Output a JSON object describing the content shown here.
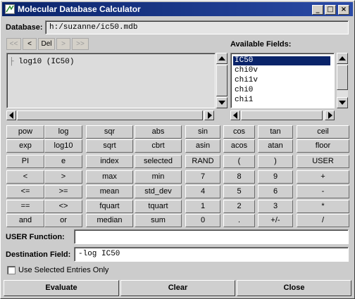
{
  "window": {
    "title": "Molecular Database Calculator",
    "controls": {
      "minimize": "_",
      "maximize": "□",
      "close": "×"
    }
  },
  "database": {
    "label": "Database:",
    "value": "h:/suzanne/ic50.mdb"
  },
  "nav": {
    "first": "<<",
    "prev": "<",
    "del": "Del",
    "next": ">",
    "last": ">>"
  },
  "formula_panel": {
    "entries": [
      "log10 (IC50)"
    ]
  },
  "available_fields": {
    "label": "Available Fields:",
    "items": [
      "IC50",
      "chi0v",
      "chi1v",
      "chi0",
      "chi1"
    ],
    "selected_index": 0
  },
  "keypad": [
    [
      "pow",
      "log",
      "sqr",
      "abs",
      "sin",
      "cos",
      "tan",
      "ceil"
    ],
    [
      "exp",
      "log10",
      "sqrt",
      "cbrt",
      "asin",
      "acos",
      "atan",
      "floor"
    ],
    [
      "PI",
      "e",
      "index",
      "selected",
      "RAND",
      "(",
      ")",
      "USER"
    ],
    [
      "<",
      ">",
      "max",
      "min",
      "7",
      "8",
      "9",
      "+"
    ],
    [
      "<=",
      ">=",
      "mean",
      "std_dev",
      "4",
      "5",
      "6",
      "-"
    ],
    [
      "==",
      "<>",
      "fquart",
      "tquart",
      "1",
      "2",
      "3",
      "*"
    ],
    [
      "and",
      "or",
      "median",
      "sum",
      "0",
      ".",
      "+/-",
      "/"
    ]
  ],
  "user_function": {
    "label": "USER Function:",
    "value": ""
  },
  "destination": {
    "label": "Destination Field:",
    "value": "-log IC50"
  },
  "use_selected": {
    "label": "Use Selected Entries Only",
    "checked": false
  },
  "actions": {
    "evaluate": "Evaluate",
    "clear": "Clear",
    "close": "Close"
  },
  "colors": {
    "title_bar": "#0a246a",
    "selection": "#0a246a",
    "window_bg": "#cccccc"
  }
}
